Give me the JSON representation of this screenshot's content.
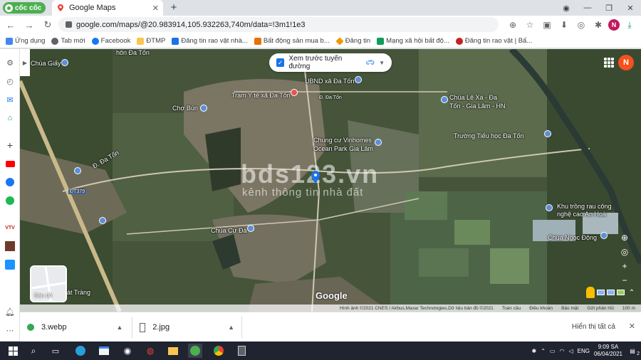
{
  "browser": {
    "brand": "cốc cốc",
    "tab_title": "Google Maps",
    "url": "google.com/maps/@20.983914,105.932263,740m/data=!3m1!1e3"
  },
  "bookmarks": [
    {
      "label": "Ứng dụng",
      "icon": "apps-icon"
    },
    {
      "label": "Tab mới",
      "icon": "globe-icon"
    },
    {
      "label": "Facebook",
      "icon": "facebook-icon"
    },
    {
      "label": "ĐTMP",
      "icon": "folder-icon"
    },
    {
      "label": "Đăng tin rao vặt nhà...",
      "icon": "house-icon"
    },
    {
      "label": "Bất động sản mua b...",
      "icon": "house-icon"
    },
    {
      "label": "Đăng tin",
      "icon": "diamond-icon"
    },
    {
      "label": "Mạng xã hội bất độ...",
      "icon": "building-icon"
    },
    {
      "label": "Đăng tin rao vặt | Bấ...",
      "icon": "circle-icon"
    }
  ],
  "map": {
    "route_preview_label": "Xem trước tuyến đường",
    "profile_initial": "N",
    "watermark_main": "bds123.vn",
    "watermark_sub": "kênh thông tin nhà đất",
    "layer_label": "Bản đồ",
    "google_logo": "Google",
    "labels": {
      "chua_giay": "Chùa Giấy",
      "don_da_ton_top": "hôn Đa Tốn",
      "tram_y_te": "Trạm Y tế xã Đa Tốn",
      "ubnd": "UBND xã Đa Tốn",
      "da_ton_road": "Đ. Đa Tốn",
      "cho_bun": "Chợ Bún",
      "chua_le_xa": "Chùa Lê Xá - Đa",
      "chua_le_xa_2": "Tốn - Gia Lâm - HN",
      "chung_cu": "Chung cư Vinhomes",
      "chung_cu_2": "Ocean Park Gia Lâm",
      "truong_tieu_hoc": "Trường Tiểu học Đa Tốn",
      "d_da_ton": "Đ. Đa Tốn",
      "dt379": "ĐT379",
      "khu_trong_rau": "Khu trồng rau công",
      "khu_trong_rau_2": "nghệ cao An Hoà",
      "chua_cu_da": "Chùa Cự Đà",
      "chua_ngoc_dong": "Chùa Ngọc Động",
      "bat_trang": "Bát Tràng"
    },
    "footer": [
      "Hình ảnh ©2021 CNES / Airbus,Maxar Technologies,Dữ liệu bản đồ ©2021",
      "Toàn cầu",
      "Điều khoản",
      "Bảo mật",
      "Gửi phản hồi",
      "100 m"
    ]
  },
  "downloads": {
    "files": [
      {
        "name": "3.webp"
      },
      {
        "name": "2.jpg"
      }
    ],
    "show_all": "Hiển thị tất cả"
  },
  "taskbar": {
    "time": "9:09 SA",
    "date": "06/04/2021",
    "language": "ENG",
    "notification_count": "2"
  }
}
